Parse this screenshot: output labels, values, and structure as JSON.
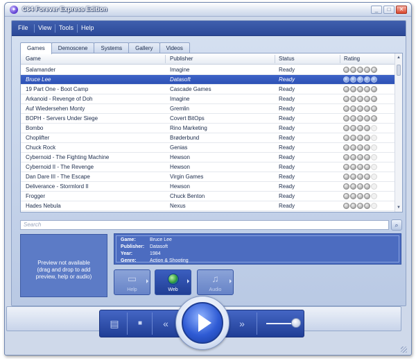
{
  "window": {
    "title": "C64 Forever Express Edition",
    "buttons": [
      "_",
      "□",
      "✕"
    ]
  },
  "menu": [
    "File",
    "View",
    "Tools",
    "Help"
  ],
  "tabs": [
    {
      "label": "Games",
      "active": true
    },
    {
      "label": "Demoscene",
      "active": false
    },
    {
      "label": "Systems",
      "active": false
    },
    {
      "label": "Gallery",
      "active": false
    },
    {
      "label": "Videos",
      "active": false
    }
  ],
  "table": {
    "columns": [
      "Game",
      "Publisher",
      "Status",
      "Rating"
    ],
    "rows": [
      {
        "game": "Salamander",
        "publisher": "Imagine",
        "status": "Ready",
        "rating": 5,
        "selected": false
      },
      {
        "game": "Bruce Lee",
        "publisher": "Datasoft",
        "status": "Ready",
        "rating": 5,
        "selected": true
      },
      {
        "game": "19 Part One - Boot Camp",
        "publisher": "Cascade Games",
        "status": "Ready",
        "rating": 5,
        "selected": false
      },
      {
        "game": "Arkanoid - Revenge of Doh",
        "publisher": "Imagine",
        "status": "Ready",
        "rating": 5,
        "selected": false
      },
      {
        "game": "Auf Wiedersehen Monty",
        "publisher": "Gremlin",
        "status": "Ready",
        "rating": 5,
        "selected": false
      },
      {
        "game": "BOPH - Servers Under Siege",
        "publisher": "Covert BitOps",
        "status": "Ready",
        "rating": 5,
        "selected": false
      },
      {
        "game": "Bombo",
        "publisher": "Rino Marketing",
        "status": "Ready",
        "rating": 4,
        "selected": false
      },
      {
        "game": "Choplifter",
        "publisher": "Brøderbund",
        "status": "Ready",
        "rating": 4,
        "selected": false
      },
      {
        "game": "Chuck Rock",
        "publisher": "Genias",
        "status": "Ready",
        "rating": 4,
        "selected": false
      },
      {
        "game": "Cybernoid - The Fighting Machine",
        "publisher": "Hewson",
        "status": "Ready",
        "rating": 4,
        "selected": false
      },
      {
        "game": "Cybernoid II - The Revenge",
        "publisher": "Hewson",
        "status": "Ready",
        "rating": 4,
        "selected": false
      },
      {
        "game": "Dan Dare III - The Escape",
        "publisher": "Virgin Games",
        "status": "Ready",
        "rating": 4,
        "selected": false
      },
      {
        "game": "Deliverance - Stormlord II",
        "publisher": "Hewson",
        "status": "Ready",
        "rating": 4,
        "selected": false
      },
      {
        "game": "Frogger",
        "publisher": "Chuck Benton",
        "status": "Ready",
        "rating": 4,
        "selected": false
      },
      {
        "game": "Hades Nebula",
        "publisher": "Nexus",
        "status": "Ready",
        "rating": 4,
        "selected": false
      }
    ]
  },
  "search": {
    "placeholder": "Search"
  },
  "preview": {
    "line1": "Preview not available",
    "line2": "(drag and drop to add",
    "line3": "preview, help or audio)"
  },
  "info": {
    "game_label": "Game:",
    "game": "Bruce Lee",
    "publisher_label": "Publisher:",
    "publisher": "Datasoft",
    "year_label": "Year:",
    "year": "1984",
    "genre_label": "Genre:",
    "genre": "Action & Shooting"
  },
  "actions": {
    "help": "Help",
    "web": "Web",
    "audio": "Audio"
  },
  "colors": {
    "accent": "#2d52b6",
    "menubar": "#3455a6"
  }
}
